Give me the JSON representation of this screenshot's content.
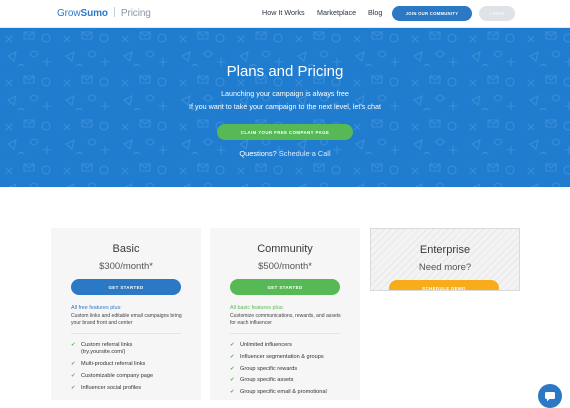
{
  "header": {
    "logo_grow": "Grow",
    "logo_sumo": "Sumo",
    "logo_section": "Pricing",
    "nav": {
      "how_it_works": "How It Works",
      "marketplace": "Marketplace",
      "blog": "Blog"
    },
    "join_label": "JOIN OUR COMMUNITY",
    "login_label": "LOGIN"
  },
  "hero": {
    "title": "Plans and Pricing",
    "line1": "Launching your campaign is always free",
    "line2": "If you want to take your campaign to the next level, let's chat",
    "cta_label": "CLAIM YOUR FREE COMPANY PAGE",
    "questions_text": "Questions?",
    "schedule_link": "Schedule a Call"
  },
  "plans": [
    {
      "name": "Basic",
      "price": "$300/month*",
      "button": "GET STARTED",
      "features_heading": "All free features plus:",
      "features_desc": "Custom links and editable email campaigns bring your brand front and center",
      "features": [
        "Custom referral links (try.yoursite.com/)",
        "Multi-product referral links",
        "Customizable company page",
        "Influencer social profiles"
      ]
    },
    {
      "name": "Community",
      "price": "$500/month*",
      "button": "GET STARTED",
      "features_heading": "All basic features plus:",
      "features_desc": "Customize communications, rewards, and assets for each influencer",
      "features": [
        "Unlimited influencers",
        "Influencer segmentation & groups",
        "Group specific rewards",
        "Group specific assets",
        "Group specific email & promotional"
      ]
    },
    {
      "name": "Enterprise",
      "price": "Need more?",
      "button": "SCHEDULE DEMO"
    }
  ],
  "icons": {
    "check": "check-icon",
    "chat": "chat-icon"
  },
  "colors": {
    "brand_blue": "#2b78c5",
    "hero_blue": "#1f7ccf",
    "green": "#57b956",
    "orange": "#f8ac1a"
  }
}
